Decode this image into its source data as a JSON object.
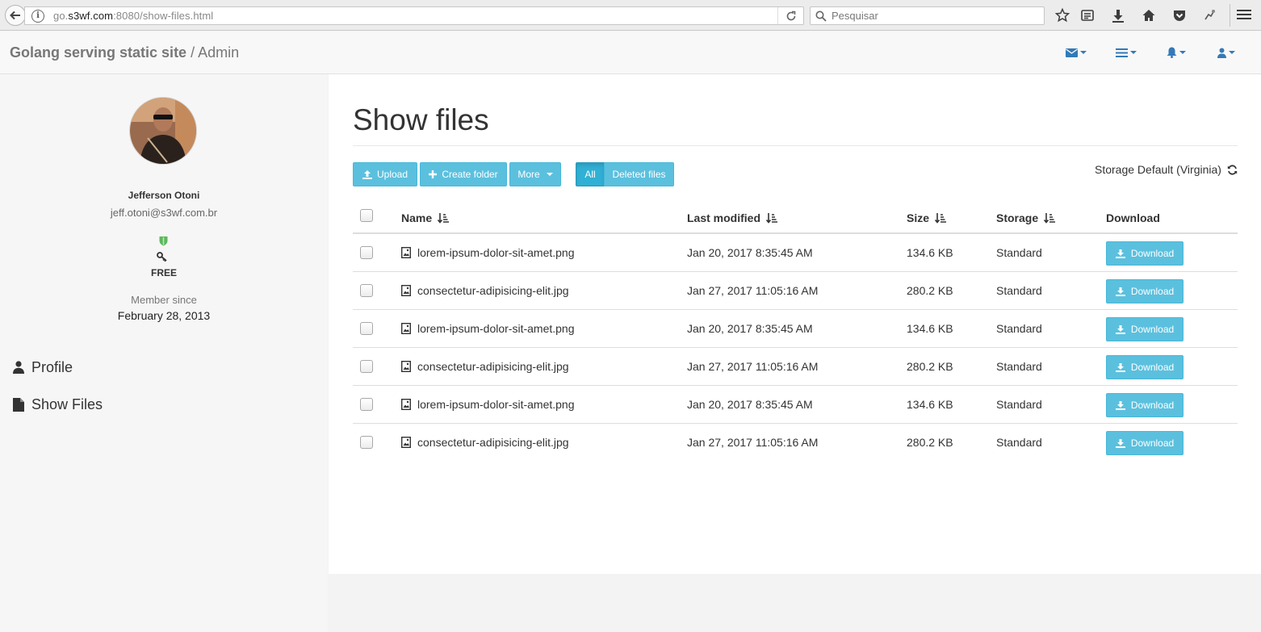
{
  "browser": {
    "url_prefix": "go.",
    "url_domain": "s3wf.com",
    "url_suffix": ":8080/show-files.html",
    "search_placeholder": "Pesquisar"
  },
  "navbar": {
    "brand": "Golang serving static site",
    "brand_suffix": " / Admin",
    "menus": [
      "envelope-icon",
      "list-icon",
      "bell-icon",
      "user-icon"
    ],
    "accent_color": "#337ab7"
  },
  "sidebar": {
    "user": {
      "name": "Jefferson Otoni",
      "email": "jeff.otoni@s3wf.com.br"
    },
    "plan": "FREE",
    "plan_color": "#5cb85c",
    "member_since_label": "Member since",
    "member_since_date": "February 28, 2013",
    "links": [
      {
        "label": "Profile",
        "icon": "user-icon"
      },
      {
        "label": "Show Files",
        "icon": "file-icon"
      }
    ]
  },
  "main": {
    "title": "Show files",
    "toolbar": {
      "upload": "Upload",
      "create_folder": "Create folder",
      "more": "More",
      "all": "All",
      "deleted": "Deleted files",
      "button_color": "#5bc0de"
    },
    "storage_label": "Storage Default (Virginia)",
    "table": {
      "headers": {
        "name": "Name",
        "last_modified": "Last modified",
        "size": "Size",
        "storage": "Storage",
        "download": "Download"
      },
      "rows": [
        {
          "name": "lorem-ipsum-dolor-sit-amet.png",
          "modified": "Jan 20, 2017 8:35:45 AM",
          "size": "134.6 KB",
          "storage": "Standard",
          "action": "Download"
        },
        {
          "name": "consectetur-adipisicing-elit.jpg",
          "modified": "Jan 27, 2017 11:05:16 AM",
          "size": "280.2 KB",
          "storage": "Standard",
          "action": "Download"
        },
        {
          "name": "lorem-ipsum-dolor-sit-amet.png",
          "modified": "Jan 20, 2017 8:35:45 AM",
          "size": "134.6 KB",
          "storage": "Standard",
          "action": "Download"
        },
        {
          "name": "consectetur-adipisicing-elit.jpg",
          "modified": "Jan 27, 2017 11:05:16 AM",
          "size": "280.2 KB",
          "storage": "Standard",
          "action": "Download"
        },
        {
          "name": "lorem-ipsum-dolor-sit-amet.png",
          "modified": "Jan 20, 2017 8:35:45 AM",
          "size": "134.6 KB",
          "storage": "Standard",
          "action": "Download"
        },
        {
          "name": "consectetur-adipisicing-elit.jpg",
          "modified": "Jan 27, 2017 11:05:16 AM",
          "size": "280.2 KB",
          "storage": "Standard",
          "action": "Download"
        }
      ]
    }
  }
}
